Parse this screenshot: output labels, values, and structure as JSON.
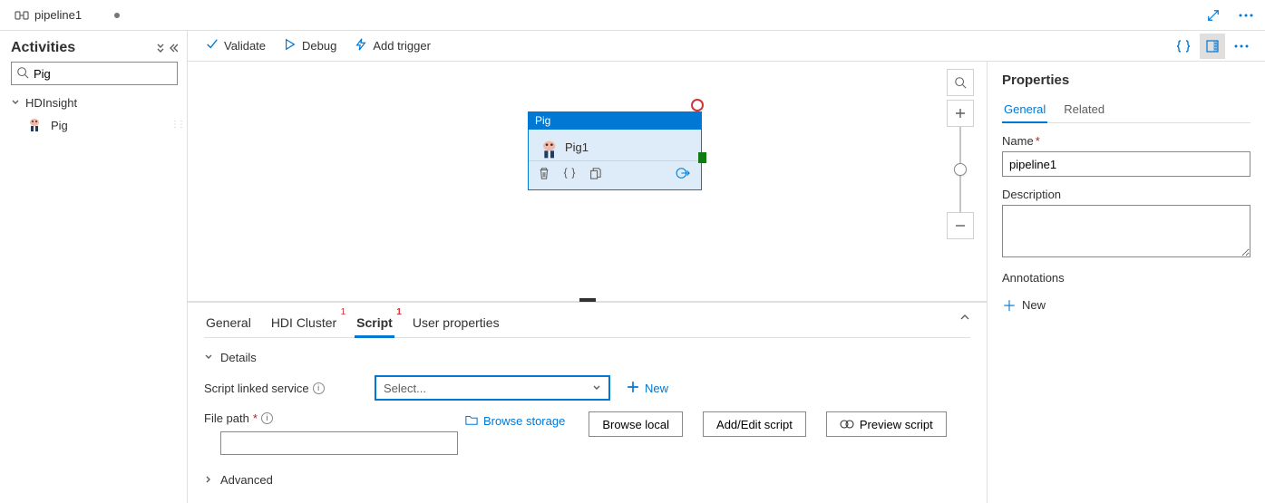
{
  "tab": {
    "title": "pipeline1"
  },
  "sidebar": {
    "title": "Activities",
    "search_value": "Pig",
    "category": "HDInsight",
    "leaf": "Pig"
  },
  "toolbar": {
    "validate": "Validate",
    "debug": "Debug",
    "trigger": "Add trigger"
  },
  "node": {
    "type": "Pig",
    "name": "Pig1"
  },
  "detail": {
    "tabs": {
      "general": "General",
      "hdi": "HDI Cluster",
      "script": "Script",
      "user": "User properties"
    },
    "section_details": "Details",
    "linked_label": "Script linked service",
    "linked_placeholder": "Select...",
    "new": "New",
    "filepath_label": "File path",
    "browse_storage": "Browse storage",
    "browse_local": "Browse local",
    "addedit": "Add/Edit script",
    "preview": "Preview script",
    "advanced": "Advanced"
  },
  "props": {
    "title": "Properties",
    "tab_general": "General",
    "tab_related": "Related",
    "name_label": "Name",
    "name_value": "pipeline1",
    "desc_label": "Description",
    "annotations_label": "Annotations",
    "new": "New"
  }
}
